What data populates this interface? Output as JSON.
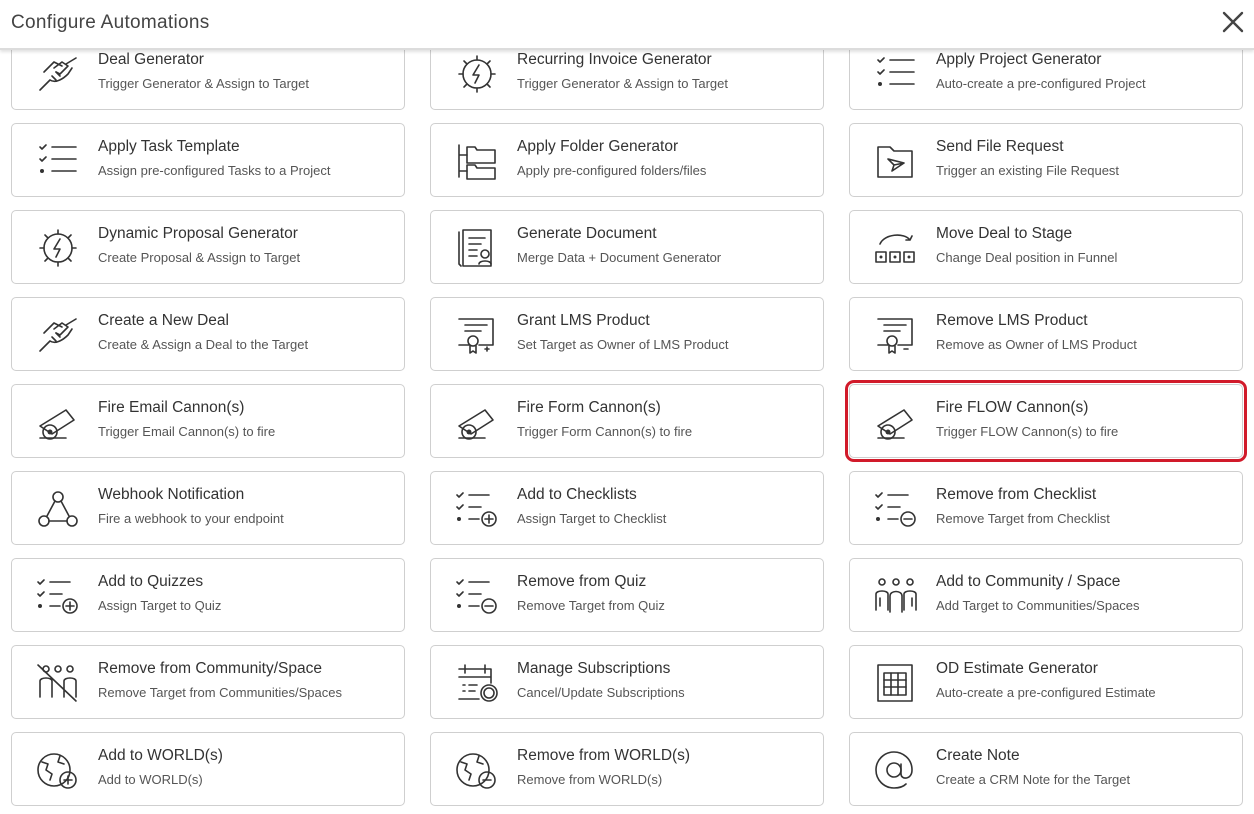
{
  "header": {
    "title": "Configure Automations"
  },
  "cards": [
    {
      "title": "Deal Generator",
      "subtitle": "Trigger Generator & Assign to Target",
      "icon": "handshake-icon"
    },
    {
      "title": "Recurring Invoice Generator",
      "subtitle": "Trigger Generator & Assign to Target",
      "icon": "gear-lightning-icon"
    },
    {
      "title": "Apply Project Generator",
      "subtitle": "Auto-create a pre-configured Project",
      "icon": "checklist-icon"
    },
    {
      "title": "Apply Task Template",
      "subtitle": "Assign pre-configured Tasks to a Project",
      "icon": "checklist-icon"
    },
    {
      "title": "Apply Folder Generator",
      "subtitle": "Apply pre-configured folders/files",
      "icon": "folder-tree-icon"
    },
    {
      "title": "Send File Request",
      "subtitle": "Trigger an existing File Request",
      "icon": "folder-send-icon"
    },
    {
      "title": "Dynamic Proposal Generator",
      "subtitle": "Create Proposal & Assign to Target",
      "icon": "gear-lightning-icon"
    },
    {
      "title": "Generate Document",
      "subtitle": "Merge Data + Document Generator",
      "icon": "document-icon"
    },
    {
      "title": "Move Deal to Stage",
      "subtitle": "Change Deal position in Funnel",
      "icon": "move-stage-icon"
    },
    {
      "title": "Create a New Deal",
      "subtitle": "Create & Assign a Deal to the Target",
      "icon": "handshake-icon"
    },
    {
      "title": "Grant LMS Product",
      "subtitle": "Set Target as Owner of LMS Product",
      "icon": "certificate-plus-icon"
    },
    {
      "title": "Remove LMS Product",
      "subtitle": "Remove as Owner of LMS Product",
      "icon": "certificate-minus-icon"
    },
    {
      "title": "Fire Email Cannon(s)",
      "subtitle": "Trigger Email Cannon(s) to fire",
      "icon": "cannon-icon"
    },
    {
      "title": "Fire Form Cannon(s)",
      "subtitle": "Trigger Form Cannon(s) to fire",
      "icon": "cannon-icon"
    },
    {
      "title": "Fire FLOW Cannon(s)",
      "subtitle": "Trigger FLOW Cannon(s) to fire",
      "icon": "cannon-icon"
    },
    {
      "title": "Webhook Notification",
      "subtitle": "Fire a webhook to your endpoint",
      "icon": "webhook-icon"
    },
    {
      "title": "Add to Checklists",
      "subtitle": "Assign Target to Checklist",
      "icon": "checklist-plus-icon"
    },
    {
      "title": "Remove from Checklist",
      "subtitle": "Remove Target from Checklist",
      "icon": "checklist-minus-icon"
    },
    {
      "title": "Add to Quizzes",
      "subtitle": "Assign Target to Quiz",
      "icon": "checklist-plus-icon"
    },
    {
      "title": "Remove from Quiz",
      "subtitle": "Remove Target from Quiz",
      "icon": "checklist-minus-icon"
    },
    {
      "title": "Add to Community / Space",
      "subtitle": "Add Target to Communities/Spaces",
      "icon": "community-icon"
    },
    {
      "title": "Remove from Community/Space",
      "subtitle": "Remove Target from Communities/Spaces",
      "icon": "community-remove-icon"
    },
    {
      "title": "Manage Subscriptions",
      "subtitle": "Cancel/Update Subscriptions",
      "icon": "calendar-gear-icon"
    },
    {
      "title": "OD Estimate Generator",
      "subtitle": "Auto-create a pre-configured Estimate",
      "icon": "estimate-sheet-icon"
    },
    {
      "title": "Add to WORLD(s)",
      "subtitle": "Add to WORLD(s)",
      "icon": "globe-plus-icon"
    },
    {
      "title": "Remove from WORLD(s)",
      "subtitle": "Remove from WORLD(s)",
      "icon": "globe-minus-icon"
    },
    {
      "title": "Create Note",
      "subtitle": "Create a CRM Note for the Target",
      "icon": "at-sign-icon"
    }
  ],
  "selected_card": "Fire FLOW Cannon(s)",
  "colors": {
    "highlight": "#d11a2a",
    "border": "#cfcfcf",
    "text": "#333333"
  }
}
